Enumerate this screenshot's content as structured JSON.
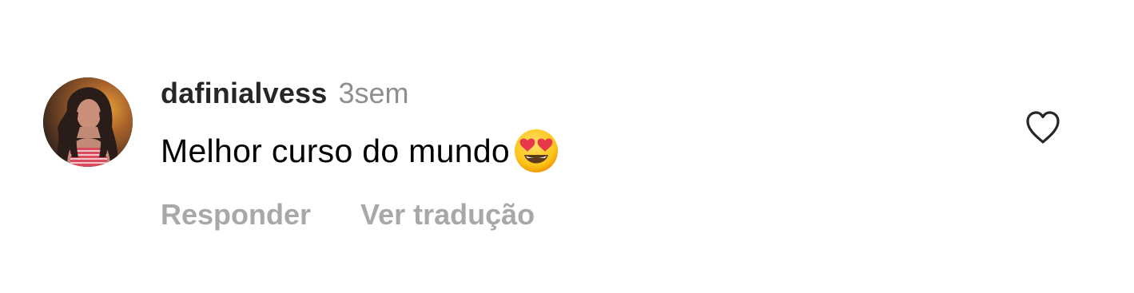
{
  "comment": {
    "username": "dafinialvess",
    "time": "3sem",
    "text": "Melhor curso do mundo",
    "emoji": "smiling-face-with-heart-eyes",
    "actions": {
      "reply": "Responder",
      "translate": "Ver tradução"
    },
    "like_icon": "heart-outline-icon"
  },
  "colors": {
    "username": "#262626",
    "muted": "#8e8e8e",
    "action": "#a8a8a8",
    "text": "#000000"
  }
}
